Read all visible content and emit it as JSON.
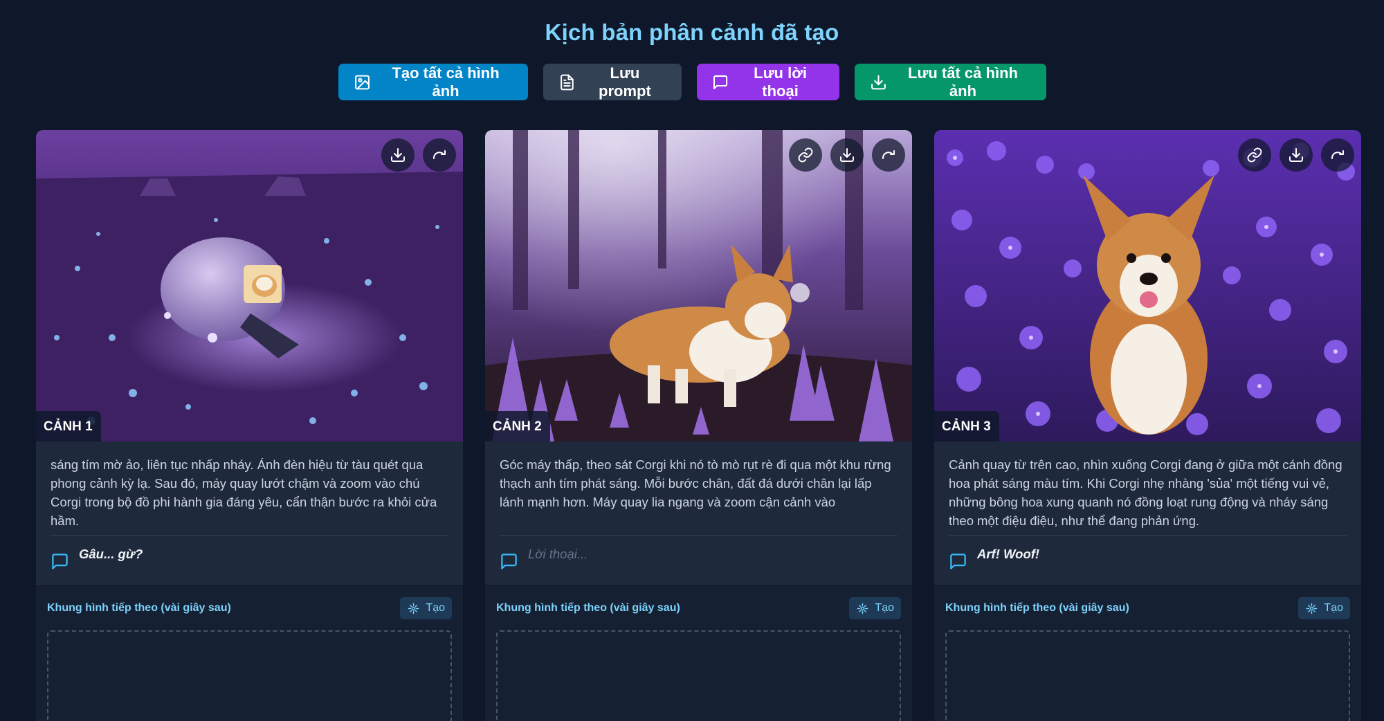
{
  "title": "Kịch bản phân cảnh đã tạo",
  "actions": {
    "create_all": "Tạo tất cả hình ảnh",
    "save_prompt": "Lưu prompt",
    "save_dialogue": "Lưu lời thoại",
    "save_all_images": "Lưu tất cả hình ảnh"
  },
  "scenes": [
    {
      "badge": "CẢNH 1",
      "description": "sáng tím mờ ảo, liên tục nhấp nháy. Ánh đèn hiệu từ tàu quét qua phong cảnh kỳ lạ. Sau đó, máy quay lướt chậm và zoom vào chú Corgi trong bộ đồ phi hành gia đáng yêu, cẩn thận bước ra khỏi cửa hầm.",
      "dialogue": "Gâu... gừ?",
      "next_frame_label": "Khung hình tiếp theo (vài giây sau)",
      "generate_label": "Tạo"
    },
    {
      "badge": "CẢNH 2",
      "description": "Góc máy thấp, theo sát Corgi khi nó tò mò rụt rè đi qua một khu rừng thạch anh tím phát sáng. Mỗi bước chân, đất đá dưới chân lại lấp lánh mạnh hơn. Máy quay lia ngang và zoom cận cảnh vào",
      "dialogue": "Lời thoại...",
      "next_frame_label": "Khung hình tiếp theo (vài giây sau)",
      "generate_label": "Tạo"
    },
    {
      "badge": "CẢNH 3",
      "description": "Cảnh quay từ trên cao, nhìn xuống Corgi đang ở giữa một cánh đồng hoa phát sáng màu tím. Khi Corgi nhẹ nhàng 'sủa' một tiếng vui vẻ, những bông hoa xung quanh nó đồng loạt rung động và nháy sáng theo một điệu điệu, như thể đang phản ứng.",
      "dialogue": "Arf! Woof!",
      "next_frame_label": "Khung hình tiếp theo (vài giây sau)",
      "generate_label": "Tạo"
    }
  ],
  "colors": {
    "background": "#0f172a",
    "card": "#1e293b",
    "title": "#7dd3fc",
    "btn_blue": "#0284c7",
    "btn_gray": "#334155",
    "btn_purple": "#9333ea",
    "btn_green": "#059669"
  }
}
